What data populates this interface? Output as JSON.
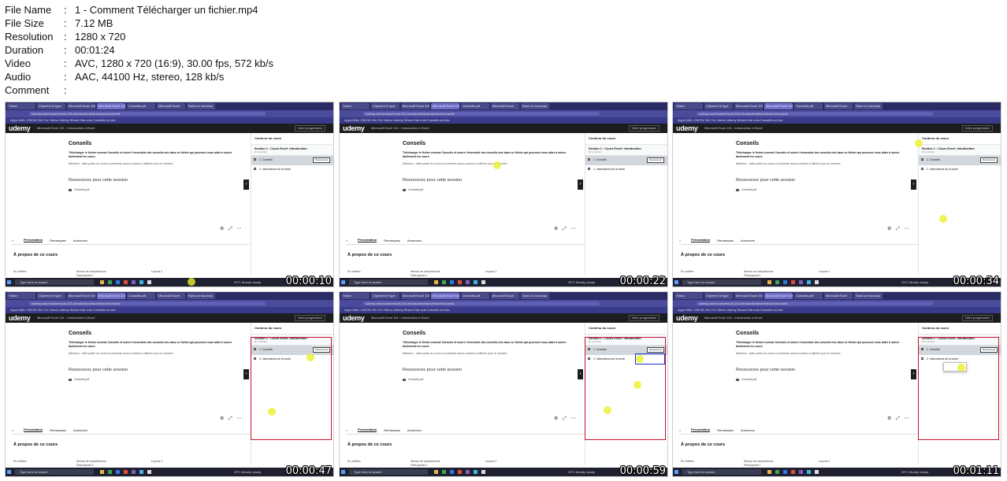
{
  "info": {
    "rows": [
      {
        "key": "File Name",
        "value": "1 - Comment Télécharger un fichier.mp4"
      },
      {
        "key": "File Size",
        "value": "7.12 MB"
      },
      {
        "key": "Resolution",
        "value": "1280 x 720"
      },
      {
        "key": "Duration",
        "value": "00:01:24"
      },
      {
        "key": "Video",
        "value": "AVC, 1280 x 720 (16:9), 30.00 fps, 572 kb/s"
      },
      {
        "key": "Audio",
        "value": "AAC, 44100 Hz, stereo, 128 kb/s"
      },
      {
        "key": "Comment",
        "value": ""
      }
    ],
    "separator": ":"
  },
  "browser": {
    "tabs": [
      "Yabox",
      "Clipment le type",
      "Microsoft Excel 101",
      "Microsoft Excel 101",
      "Conseils.pdf",
      "Microsoft Excel",
      "Sans un nouveau"
    ],
    "url": "udemy.com/course/excel-101-introduction/learn/lecture/conseils",
    "bookmarks": "Apps   MAIL OSION   Citn Tm   Yahoo   Udemy   Wrave   Kab cuts   Consells   sol   skc"
  },
  "udemy": {
    "logo": "udemy",
    "course_title": "Microsoft Excel 101 : Introduction à Excel",
    "progress": "Votre progression",
    "lesson_title": "Conseils",
    "lesson_desc": "Télécharger le fichier nommé Conseils et suivre l'ensemble des conseils mis dans ce fichier qui pourront vous aider à suivre facilement les cours",
    "lesson_note": "Attention : cette partie du cours ne présente aucun contenu à afficher pour le moment",
    "resources_title": "Ressources pour cette session",
    "resource_file": "Conseils.pdf",
    "next_icon": "chevron-right-icon",
    "controls": "⚙ ⤢ ⋯",
    "tabs": [
      "Présentation",
      "Remarques",
      "Annonces"
    ],
    "search_icon": "search-icon",
    "about": "À propos de ce cours",
    "stats": [
      "En chiffres",
      "Niveau de compétences",
      "Participants 0",
      "Leçons 2"
    ]
  },
  "sidebar": {
    "title": "Contenu du cours",
    "section": "Section 1 : Cours Excel: Introduction",
    "section_meta": "0 / 1 | 6 min",
    "items": [
      "1. Conseils",
      "2. Informations de la vente"
    ],
    "resources_label": "Ressources"
  },
  "taskbar": {
    "search": "Type here to search",
    "weather": "29°C  Mostly cloudy"
  },
  "thumbs": [
    {
      "time": "00:00:10"
    },
    {
      "time": "00:00:22"
    },
    {
      "time": "00:00:34"
    },
    {
      "time": "00:00:47"
    },
    {
      "time": "00:00:59"
    },
    {
      "time": "00:01:11"
    }
  ]
}
